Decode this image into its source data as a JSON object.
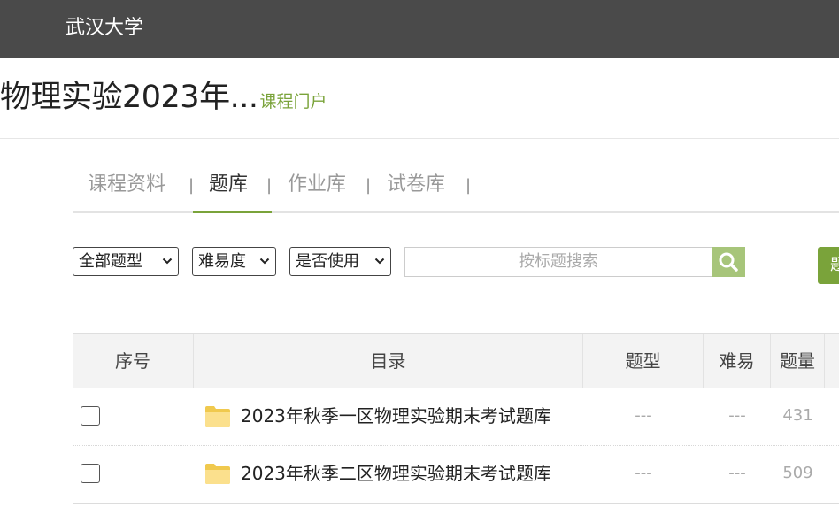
{
  "header": {
    "university": "武汉大学"
  },
  "course": {
    "name": "物理实验2023年...",
    "portal_link": "课程门户"
  },
  "tabs": [
    {
      "label": "课程资料",
      "active": false
    },
    {
      "label": "题库",
      "active": true
    },
    {
      "label": "作业库",
      "active": false
    },
    {
      "label": "试卷库",
      "active": false
    }
  ],
  "tab_separator": "|",
  "filters": {
    "type": "全部题型",
    "difficulty": "难易度",
    "used": "是否使用",
    "search_placeholder": "按标题搜索",
    "action_button": "题"
  },
  "table": {
    "headers": [
      "序号",
      "目录",
      "题型",
      "难易",
      "题量"
    ],
    "rows": [
      {
        "name": "2023年秋季一区物理实验期末考试题库",
        "type": "---",
        "difficulty": "---",
        "count": "431"
      },
      {
        "name": "2023年秋季二区物理实验期末考试题库",
        "type": "---",
        "difficulty": "---",
        "count": "509"
      }
    ]
  },
  "colors": {
    "accent": "#7aa33a",
    "topbar": "#4a4a4a",
    "search_button": "#a7c57a"
  }
}
